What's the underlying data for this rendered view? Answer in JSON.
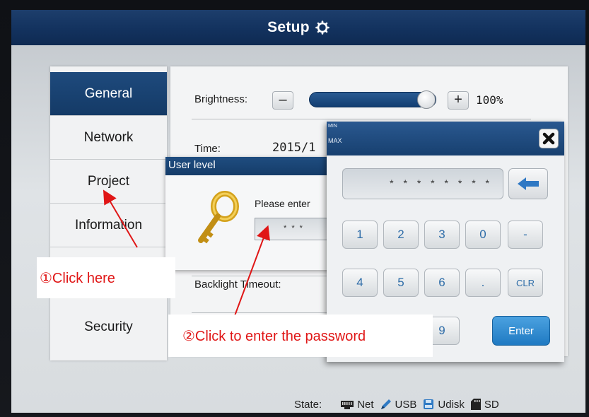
{
  "header": {
    "title": "Setup"
  },
  "sidebar": {
    "items": [
      {
        "label": "General"
      },
      {
        "label": "Network"
      },
      {
        "label": "Project"
      },
      {
        "label": "Information"
      },
      {
        "label": ""
      },
      {
        "label": "Security"
      }
    ]
  },
  "main": {
    "brightness_label": "Brightness:",
    "minus": "–",
    "plus": "+",
    "brightness_value": "100%",
    "brightness_level": 1.0,
    "time_label": "Time:",
    "time_value": "2015/1",
    "backlight_label": "Backlight Timeout:"
  },
  "user_dialog": {
    "title": "User level",
    "prompt": "Please enter",
    "password_mask": "* * *"
  },
  "keypad": {
    "min_label": "MIN",
    "max_label": "MAX",
    "display": "* * * * * * * *",
    "keys_row1": [
      "1",
      "2",
      "3",
      "0",
      "-"
    ],
    "keys_row2": [
      "4",
      "5",
      "6",
      ".",
      "CLR"
    ],
    "key_9": "9",
    "enter": "Enter"
  },
  "status": {
    "label": "State:",
    "net": "Net",
    "usb": "USB",
    "udisk": "Udisk",
    "sd": "SD"
  },
  "annotations": {
    "step1": "①Click here",
    "step2": "②Click to enter the password"
  },
  "colors": {
    "accent": "#153c69",
    "annotation": "#e01616",
    "enter": "#1f7ac2"
  }
}
